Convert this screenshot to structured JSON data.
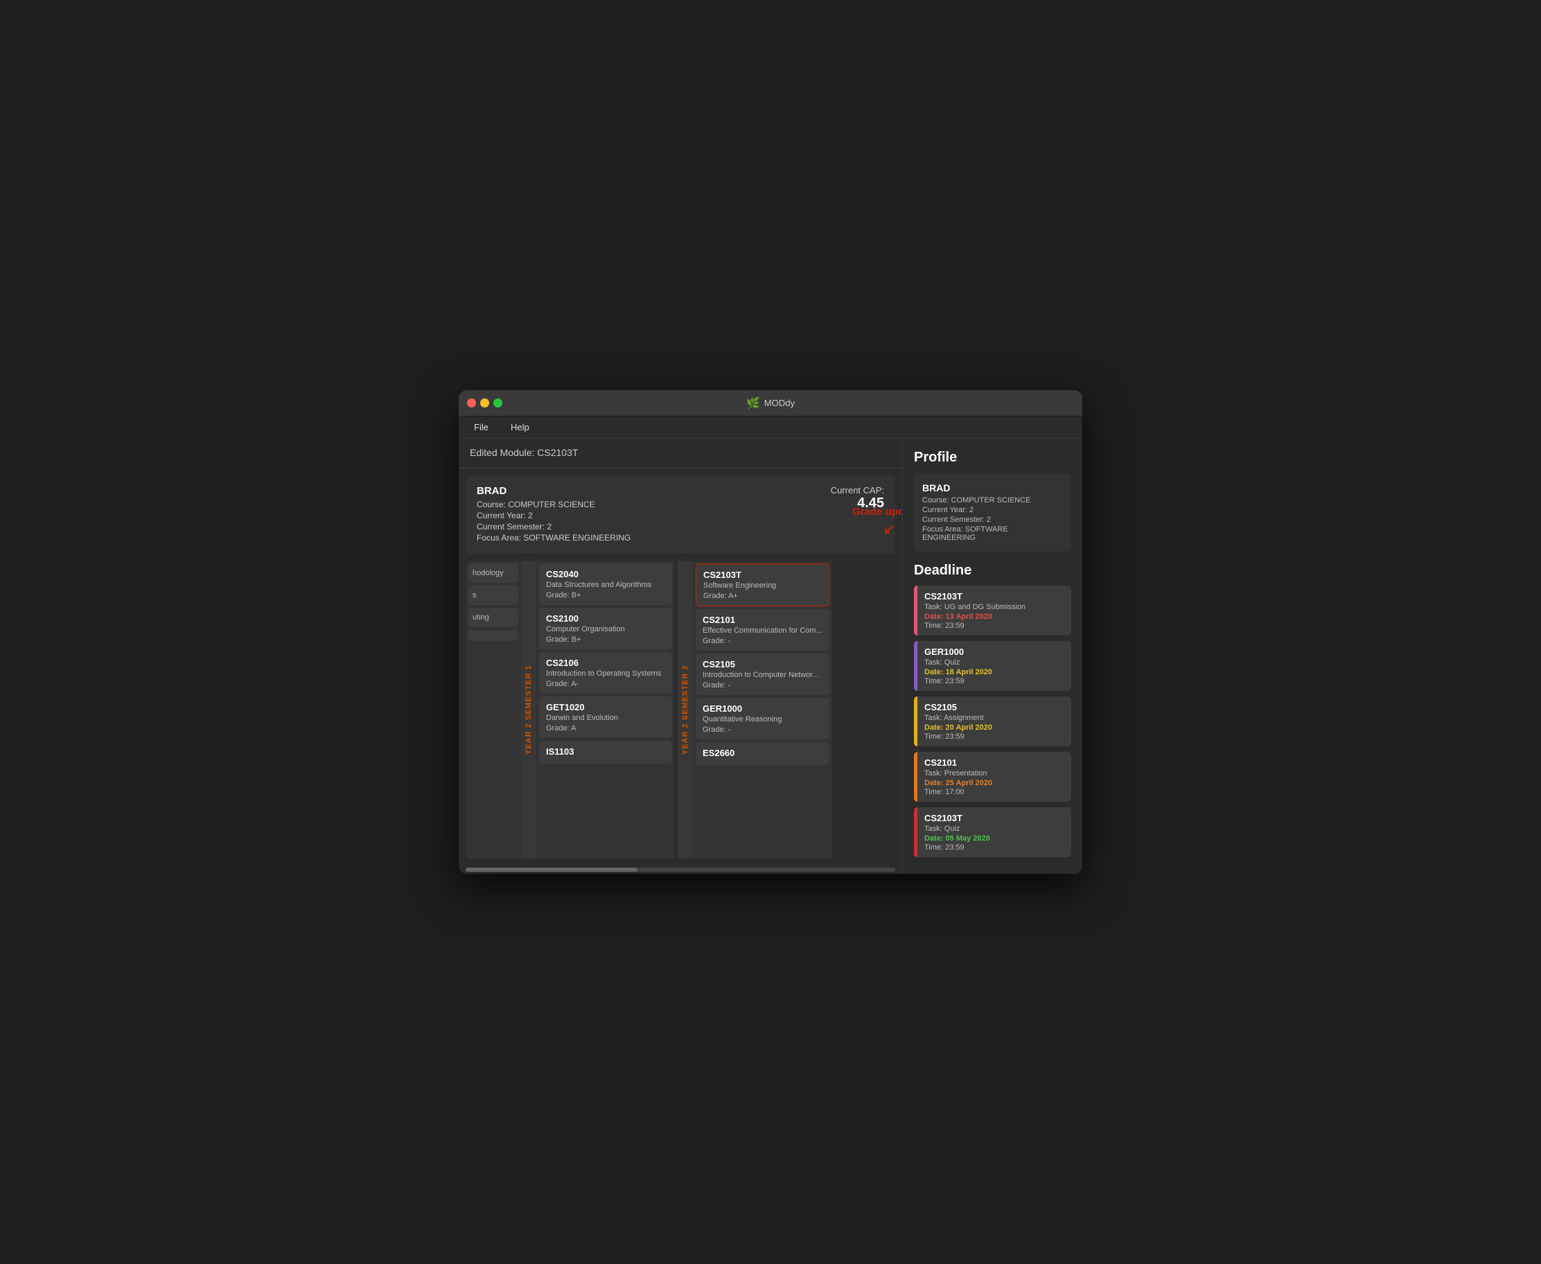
{
  "window": {
    "title": "MODdy",
    "icon": "🌿"
  },
  "menubar": {
    "items": [
      "File",
      "Help"
    ]
  },
  "edited_module": {
    "label": "Edited Module: CS2103T"
  },
  "profile_main": {
    "name": "BRAD",
    "course": "Course: COMPUTER SCIENCE",
    "year": "Current Year: 2",
    "semester": "Current Semester: 2",
    "focus": "Focus Area: SOFTWARE ENGINEERING",
    "cap_label": "Current CAP:",
    "cap_value": "4.45",
    "grade_updated": "Grade updated"
  },
  "partial_column": {
    "items": [
      {
        "text": "hodology"
      },
      {
        "text": "s"
      },
      {
        "text": "uting"
      },
      {
        "text": ""
      }
    ]
  },
  "semester1_column": {
    "label": "YEAR 2 SEMESTER 1",
    "modules": [
      {
        "code": "CS2040",
        "name": "Data Structures and Algorithms",
        "grade": "Grade: B+"
      },
      {
        "code": "CS2100",
        "name": "Computer Organisation",
        "grade": "Grade: B+"
      },
      {
        "code": "CS2106",
        "name": "Introduction to Operating Systems",
        "grade": "Grade: A-"
      },
      {
        "code": "GET1020",
        "name": "Darwin and Evolution",
        "grade": "Grade: A"
      },
      {
        "code": "IS1103",
        "name": "",
        "grade": ""
      }
    ]
  },
  "semester2_column": {
    "label": "YEAR 2 SEMESTER 2",
    "modules": [
      {
        "code": "CS2103T",
        "name": "Software Engineering",
        "grade": "Grade: A+",
        "highlighted": true
      },
      {
        "code": "CS2101",
        "name": "Effective Communication for Com...",
        "grade": "Grade: -"
      },
      {
        "code": "CS2105",
        "name": "Introduction to Computer Networ...",
        "grade": "Grade: -"
      },
      {
        "code": "GER1000",
        "name": "Quantitative Reasoning",
        "grade": "Grade: -"
      },
      {
        "code": "ES2660",
        "name": "",
        "grade": ""
      }
    ]
  },
  "profile_sidebar": {
    "title": "Profile",
    "name": "BRAD",
    "course": "Course: COMPUTER SCIENCE",
    "year": "Current Year: 2",
    "semester": "Current Semester: 2",
    "focus": "Focus Area: SOFTWARE ENGINEERING"
  },
  "deadlines": {
    "title": "Deadline",
    "items": [
      {
        "code": "CS2103T",
        "task": "Task: UG and DG Submission",
        "date": "Date: 13 April 2020",
        "time": "Time: 23:59",
        "date_color": "date-red",
        "accent_color": "color-pink"
      },
      {
        "code": "GER1000",
        "task": "Task: Quiz",
        "date": "Date: 18 April 2020",
        "time": "Time: 23:59",
        "date_color": "date-yellow",
        "accent_color": "color-purple"
      },
      {
        "code": "CS2105",
        "task": "Task: Assignment",
        "date": "Date: 20 April 2020",
        "time": "Time: 23:59",
        "date_color": "date-yellow",
        "accent_color": "color-yellow"
      },
      {
        "code": "CS2101",
        "task": "Task: Presentation",
        "date": "Date: 25 April 2020",
        "time": "Time: 17:00",
        "date_color": "date-orange",
        "accent_color": "color-orange"
      },
      {
        "code": "CS2103T",
        "task": "Task: Quiz",
        "date": "Date: 05 May 2020",
        "time": "Time: 23:59",
        "date_color": "date-green",
        "accent_color": "color-red"
      }
    ]
  }
}
